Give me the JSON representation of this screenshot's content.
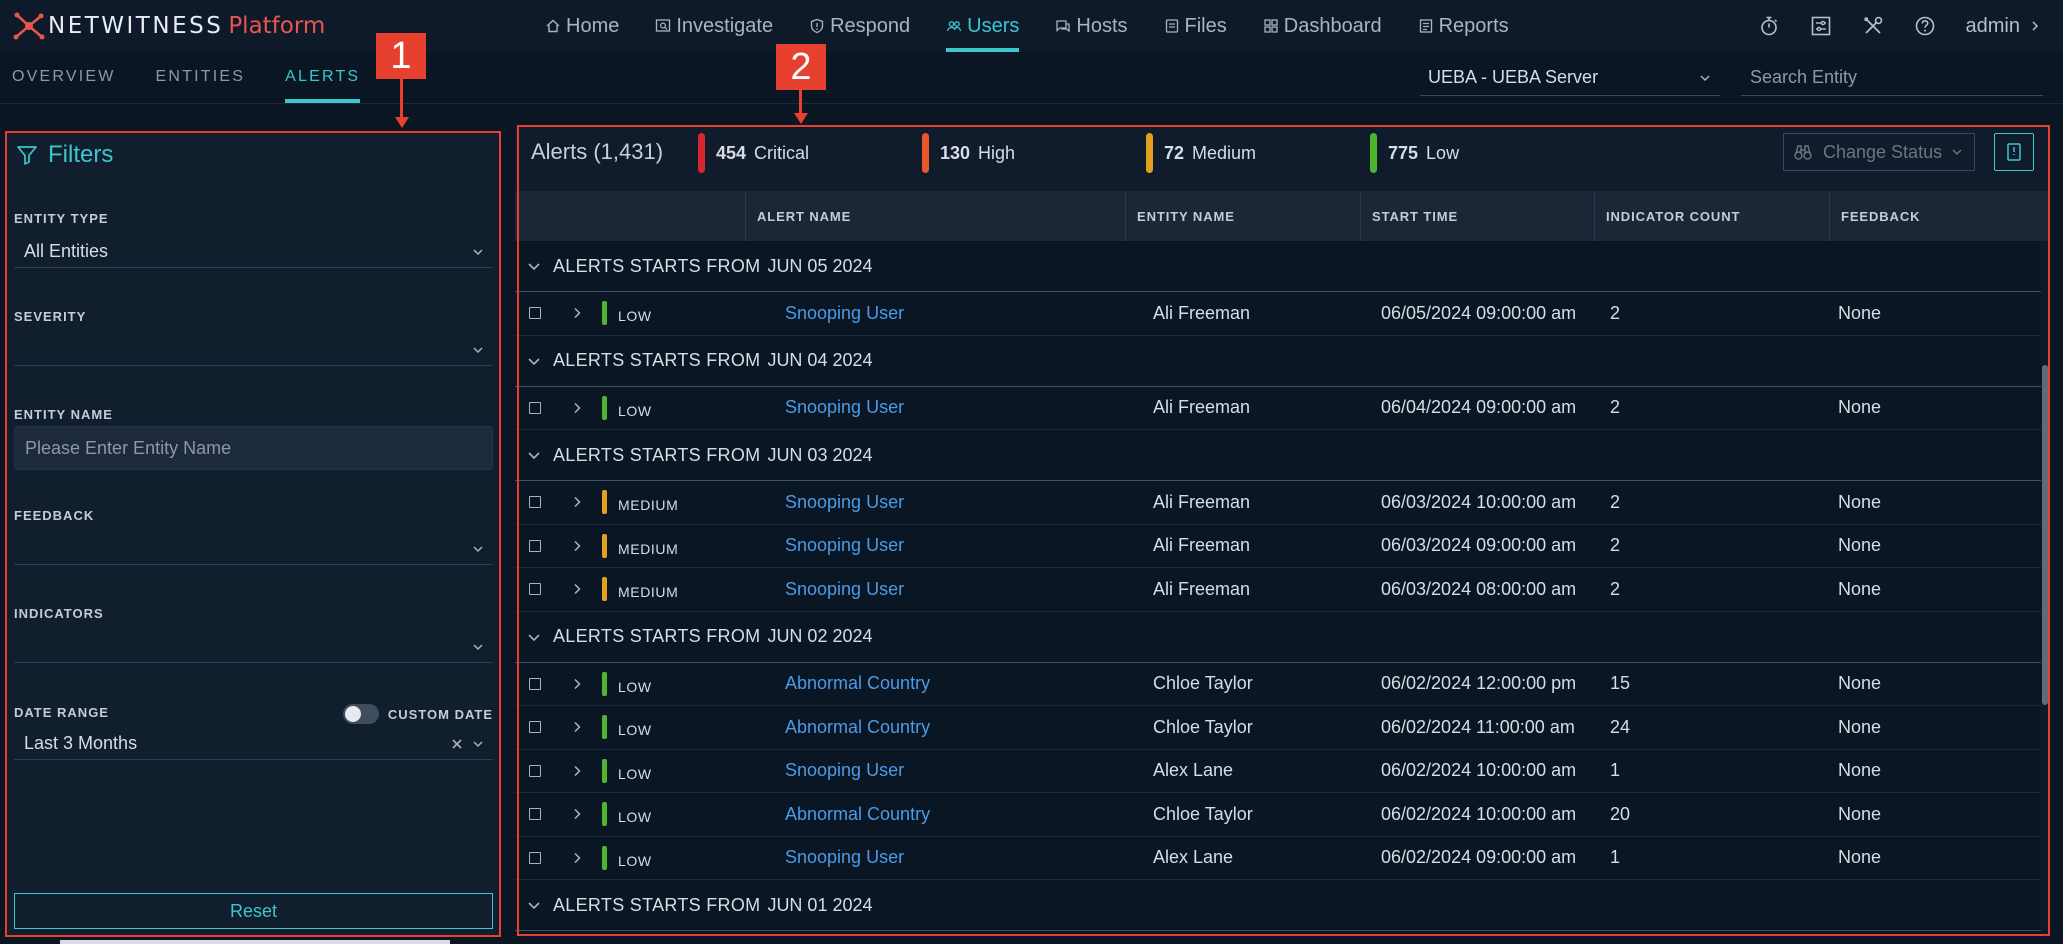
{
  "brand": {
    "name": "NETWITNESS",
    "sub": "Platform"
  },
  "nav": [
    {
      "label": "Home",
      "icon": "home-icon"
    },
    {
      "label": "Investigate",
      "icon": "investigate-icon"
    },
    {
      "label": "Respond",
      "icon": "respond-icon"
    },
    {
      "label": "Users",
      "icon": "users-icon",
      "active": true
    },
    {
      "label": "Hosts",
      "icon": "hosts-icon"
    },
    {
      "label": "Files",
      "icon": "files-icon"
    },
    {
      "label": "Dashboard",
      "icon": "dashboard-icon"
    },
    {
      "label": "Reports",
      "icon": "reports-icon"
    }
  ],
  "user": {
    "name": "admin"
  },
  "subnav": {
    "tabs": [
      "OVERVIEW",
      "ENTITIES",
      "ALERTS"
    ],
    "active": "ALERTS"
  },
  "server": {
    "selected": "UEBA - UEBA Server"
  },
  "search": {
    "placeholder": "Search Entity"
  },
  "callouts": {
    "one": "1",
    "two": "2"
  },
  "filters": {
    "title": "Filters",
    "entity_type_label": "ENTITY TYPE",
    "entity_type_value": "All Entities",
    "severity_label": "SEVERITY",
    "severity_value": "",
    "entity_name_label": "ENTITY NAME",
    "entity_name_placeholder": "Please Enter Entity Name",
    "feedback_label": "FEEDBACK",
    "feedback_value": "",
    "indicators_label": "INDICATORS",
    "indicators_value": "",
    "date_range_label": "DATE RANGE",
    "custom_date_label": "CUSTOM DATE",
    "custom_date_on": false,
    "date_range_value": "Last 3 Months",
    "reset_label": "Reset"
  },
  "alerts": {
    "title": "Alerts (1,431)",
    "summary": [
      {
        "count": "454",
        "label": "Critical",
        "color": "#d8262e"
      },
      {
        "count": "130",
        "label": "High",
        "color": "#e8562b"
      },
      {
        "count": "72",
        "label": "Medium",
        "color": "#e2a021"
      },
      {
        "count": "775",
        "label": "Low",
        "color": "#4fb42e"
      }
    ],
    "change_status_label": "Change Status",
    "columns": [
      "ALERT NAME",
      "ENTITY NAME",
      "START TIME",
      "INDICATOR COUNT",
      "FEEDBACK"
    ],
    "group_prefix": "ALERTS STARTS FROM",
    "groups": [
      {
        "date": "JUN 05 2024",
        "rows": [
          {
            "severity": "LOW",
            "name": "Snooping User",
            "entity": "Ali Freeman",
            "time": "06/05/2024 09:00:00 am",
            "count": "2",
            "feedback": "None"
          }
        ]
      },
      {
        "date": "JUN 04 2024",
        "rows": [
          {
            "severity": "LOW",
            "name": "Snooping User",
            "entity": "Ali Freeman",
            "time": "06/04/2024 09:00:00 am",
            "count": "2",
            "feedback": "None"
          }
        ]
      },
      {
        "date": "JUN 03 2024",
        "rows": [
          {
            "severity": "MEDIUM",
            "name": "Snooping User",
            "entity": "Ali Freeman",
            "time": "06/03/2024 10:00:00 am",
            "count": "2",
            "feedback": "None"
          },
          {
            "severity": "MEDIUM",
            "name": "Snooping User",
            "entity": "Ali Freeman",
            "time": "06/03/2024 09:00:00 am",
            "count": "2",
            "feedback": "None"
          },
          {
            "severity": "MEDIUM",
            "name": "Snooping User",
            "entity": "Ali Freeman",
            "time": "06/03/2024 08:00:00 am",
            "count": "2",
            "feedback": "None"
          }
        ]
      },
      {
        "date": "JUN 02 2024",
        "rows": [
          {
            "severity": "LOW",
            "name": "Abnormal Country",
            "entity": "Chloe Taylor",
            "time": "06/02/2024 12:00:00 pm",
            "count": "15",
            "feedback": "None"
          },
          {
            "severity": "LOW",
            "name": "Abnormal Country",
            "entity": "Chloe Taylor",
            "time": "06/02/2024 11:00:00 am",
            "count": "24",
            "feedback": "None"
          },
          {
            "severity": "LOW",
            "name": "Snooping User",
            "entity": "Alex Lane",
            "time": "06/02/2024 10:00:00 am",
            "count": "1",
            "feedback": "None"
          },
          {
            "severity": "LOW",
            "name": "Abnormal Country",
            "entity": "Chloe Taylor",
            "time": "06/02/2024 10:00:00 am",
            "count": "20",
            "feedback": "None"
          },
          {
            "severity": "LOW",
            "name": "Snooping User",
            "entity": "Alex Lane",
            "time": "06/02/2024 09:00:00 am",
            "count": "1",
            "feedback": "None"
          }
        ]
      },
      {
        "date": "JUN 01 2024",
        "rows": []
      }
    ]
  },
  "colors": {
    "accent": "#3cc6ce",
    "link": "#4a9be6",
    "annotation": "#e8402f",
    "severity_low": "#4fb42e",
    "severity_medium": "#e2a021"
  }
}
